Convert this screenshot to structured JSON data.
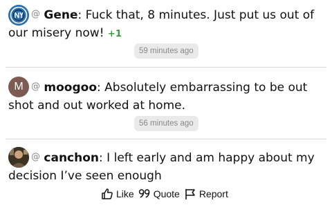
{
  "comments": [
    {
      "author": "Gene",
      "at": "@",
      "sep": ": ",
      "text": "Fuck that, 8 minutes. Just put us out of our misery now!",
      "plus": "+1",
      "time": "59 minutes ago"
    },
    {
      "author": "moogoo",
      "at": "@",
      "sep": ": ",
      "avatar_letter": "M",
      "text": "Absolutely embarrassing to be out shot and out worked at home.",
      "time": "56 minutes ago"
    },
    {
      "author": "canchon",
      "at": "@",
      "sep": ": ",
      "text": "I left early and am happy about my decision I’ve seen enough"
    }
  ],
  "actions": {
    "like": "Like",
    "quote": "Quote",
    "report": "Report"
  },
  "colors": {
    "avatar_gene": "#2b6fb0",
    "avatar_moogoo": "#7d5a52",
    "plus": "#3a9a3a"
  },
  "icons": [
    "nycfc-logo-avatar",
    "thumbs-up-icon",
    "quote-icon",
    "flag-icon"
  ]
}
